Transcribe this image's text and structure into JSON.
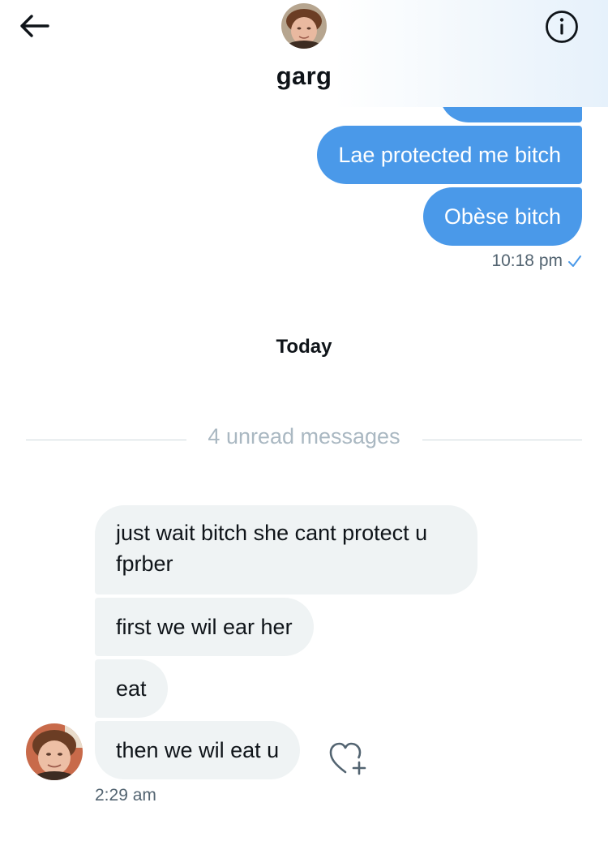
{
  "header": {
    "title": "garg",
    "back_icon": "arrow-left-icon",
    "info_icon": "info-circle-icon"
  },
  "sent_messages": [
    {
      "text": ""
    },
    {
      "text": "Lae protected me bitch"
    },
    {
      "text": "Obèse bitch"
    }
  ],
  "sent_time": "10:18 pm",
  "day_label": "Today",
  "unread_label": "4 unread messages",
  "received_messages": [
    {
      "text": "just wait bitch she cant protect u fprber"
    },
    {
      "text": "first we wil ear her"
    },
    {
      "text": "eat"
    },
    {
      "text": "then we wil eat u"
    }
  ],
  "received_time": "2:29 am",
  "colors": {
    "sent_bubble": "#4a99e9",
    "received_bubble": "#eff3f4",
    "muted_text": "#536471",
    "divider": "#cfd9de"
  }
}
